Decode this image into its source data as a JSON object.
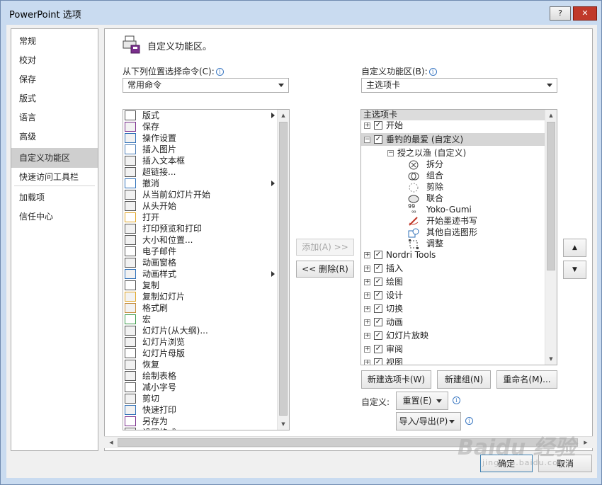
{
  "window": {
    "title": "PowerPoint 选项",
    "help": "?",
    "close": "✕"
  },
  "nav": {
    "items": [
      "常规",
      "校对",
      "保存",
      "版式",
      "语言",
      "高级",
      "自定义功能区",
      "快速访问工具栏",
      "加载项",
      "信任中心"
    ]
  },
  "header": {
    "title": "自定义功能区。"
  },
  "left": {
    "label": "从下列位置选择命令(C):",
    "combo": "常用命令",
    "commands": [
      "版式",
      "保存",
      "操作设置",
      "插入图片",
      "插入文本框",
      "超链接...",
      "撤消",
      "从当前幻灯片开始",
      "从头开始",
      "打开",
      "打印预览和打印",
      "大小和位置...",
      "电子邮件",
      "动画窗格",
      "动画样式",
      "复制",
      "复制幻灯片",
      "格式刷",
      "宏",
      "幻灯片(从大纲)...",
      "幻灯片浏览",
      "幻灯片母版",
      "恢复",
      "绘制表格",
      "减小字号",
      "剪切",
      "快速打印",
      "另存为",
      "设置格式"
    ]
  },
  "middle": {
    "add": "添加(A) >>",
    "remove": "<< 删除(R)"
  },
  "right": {
    "label": "自定义功能区(B):",
    "combo": "主选项卡",
    "tree_header": "主选项卡",
    "tabs": [
      {
        "label": "开始"
      },
      {
        "label": "垂钓的最爱 (自定义)"
      },
      {
        "label": "授之以渔 (自定义)"
      },
      {
        "label": "拆分"
      },
      {
        "label": "组合"
      },
      {
        "label": "剪除"
      },
      {
        "label": "联合"
      },
      {
        "label": "Yoko-Gumi"
      },
      {
        "label": "开始墨迹书写"
      },
      {
        "label": "其他自选图形"
      },
      {
        "label": "调整"
      },
      {
        "label": "Nordri Tools"
      },
      {
        "label": "插入"
      },
      {
        "label": "绘图"
      },
      {
        "label": "设计"
      },
      {
        "label": "切换"
      },
      {
        "label": "动画"
      },
      {
        "label": "幻灯片放映"
      },
      {
        "label": "审阅"
      },
      {
        "label": "视图"
      }
    ],
    "new_tab": "新建选项卡(W)",
    "new_group": "新建组(N)",
    "rename": "重命名(M)...",
    "customize_label": "自定义:",
    "reset": "重置(E)",
    "import_export": "导入/导出(P)"
  },
  "footer": {
    "ok": "确定",
    "cancel": "取消"
  },
  "watermark": {
    "brand": "Baidu 经验",
    "url": "jingyan.baidu.com"
  }
}
